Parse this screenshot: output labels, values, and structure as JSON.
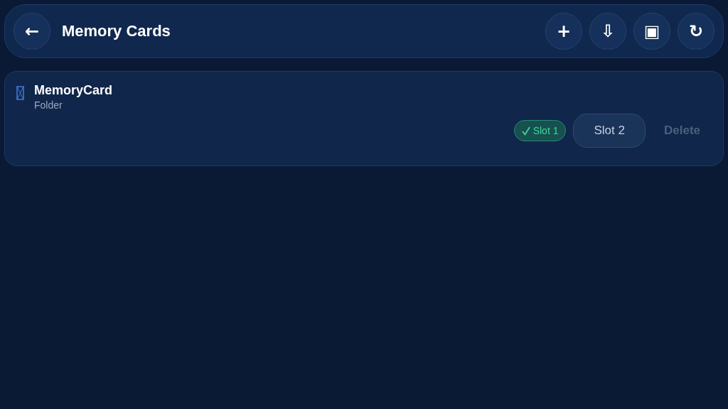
{
  "header": {
    "back": "←",
    "title": "Memory Cards",
    "actions": [
      "+",
      "⇩",
      "▣",
      "↻"
    ]
  },
  "cards": [
    {
      "name": "MemoryCard",
      "type": "Folder",
      "slots": [
        {
          "label": "Slot 1",
          "selected": true
        },
        {
          "label": "Slot 2",
          "selected": false
        }
      ],
      "delete": {
        "label": "Delete",
        "disabled": true
      }
    }
  ]
}
